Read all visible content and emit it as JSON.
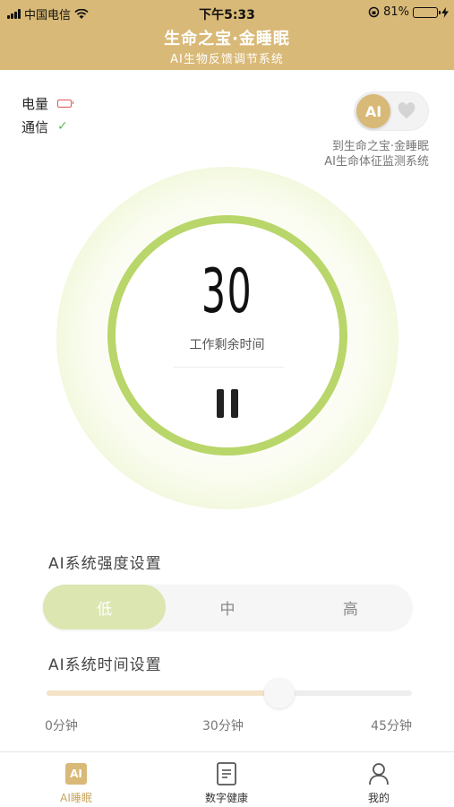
{
  "status_bar": {
    "carrier": "中国电信",
    "time": "下午5:33",
    "battery_percent": "81%",
    "battery_level": 0.81
  },
  "header": {
    "title": "生命之宝·金睡眠",
    "subtitle": "AI生物反馈调节系统"
  },
  "indicators": {
    "battery_label": "电量",
    "comm_label": "通信"
  },
  "ai_toggle": {
    "knob_label": "AI",
    "note_line1": "到生命之宝·金睡眠",
    "note_line2": "AI生命体征监测系统"
  },
  "dial": {
    "remaining": "30",
    "label": "工作剩余时间"
  },
  "intensity": {
    "title": "AI系统强度设置",
    "options": [
      "低",
      "中",
      "高"
    ],
    "selected": "低"
  },
  "time_setting": {
    "title": "AI系统时间设置",
    "labels": [
      "0分钟",
      "30分钟",
      "45分钟"
    ],
    "value_fraction": 0.65
  },
  "tabbar": {
    "tabs": [
      {
        "label": "AI睡眠",
        "icon": "ai-icon",
        "active": true,
        "badge": "AI"
      },
      {
        "label": "数字健康",
        "icon": "document-icon",
        "active": false
      },
      {
        "label": "我的",
        "icon": "user-icon",
        "active": false
      }
    ]
  },
  "colors": {
    "brand_gold": "#d9b977",
    "ring_green": "#b9d66a",
    "active_segment": "#dbe6b1"
  }
}
